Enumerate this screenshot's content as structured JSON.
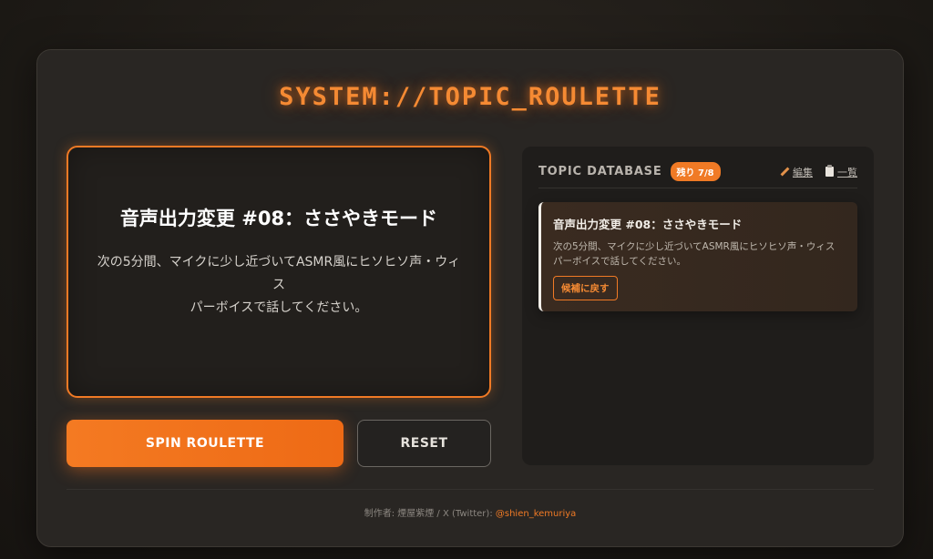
{
  "app": {
    "title": "SYSTEM://TOPIC_ROULETTE"
  },
  "display": {
    "topic_title": "音声出力変更 #08：ささやきモード",
    "topic_desc_line1": "次の5分間、マイクに少し近づいてASMR風にヒソヒソ声・ウィス",
    "topic_desc_line2": "パーボイスで話してください。"
  },
  "controls": {
    "spin_label": "SPIN ROULETTE",
    "reset_label": "RESET"
  },
  "database": {
    "title": "TOPIC DATABASE",
    "badge": "残り 7/8",
    "edit_label": "編集",
    "list_label": "一覧",
    "card": {
      "title": "音声出力変更 #08：ささやきモード",
      "desc_line1": "次の5分間、マイクに少し近づいてASMR風にヒソヒソ声・ウィス",
      "desc_line2": "パーボイスで話してください。",
      "return_label": "候補に戻す"
    }
  },
  "footer": {
    "credit": "制作者: 煙屋紫煙 / X (Twitter): ",
    "handle": "@shien_kemuriya"
  },
  "colors": {
    "accent": "#f07a25",
    "background": "#292623"
  },
  "icons": {
    "edit": "pencil-icon",
    "list": "clipboard-icon"
  }
}
